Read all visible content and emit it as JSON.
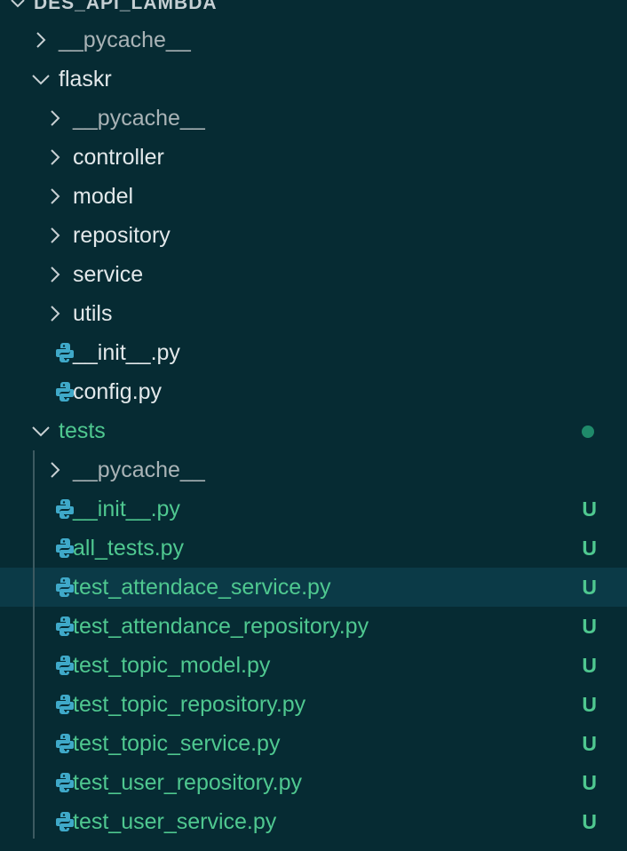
{
  "explorer": {
    "root_title": "DES_API_LAMBDA",
    "rows": [
      {
        "label": "__pycache__",
        "kind": "folder",
        "expanded": false,
        "color": "dim",
        "badge": ""
      },
      {
        "label": "flaskr",
        "kind": "folder",
        "expanded": true,
        "color": "white",
        "badge": ""
      },
      {
        "label": "__pycache__",
        "kind": "folder",
        "expanded": false,
        "color": "dim",
        "badge": ""
      },
      {
        "label": "controller",
        "kind": "folder",
        "expanded": false,
        "color": "white",
        "badge": ""
      },
      {
        "label": "model",
        "kind": "folder",
        "expanded": false,
        "color": "white",
        "badge": ""
      },
      {
        "label": "repository",
        "kind": "folder",
        "expanded": false,
        "color": "white",
        "badge": ""
      },
      {
        "label": "service",
        "kind": "folder",
        "expanded": false,
        "color": "white",
        "badge": ""
      },
      {
        "label": "utils",
        "kind": "folder",
        "expanded": false,
        "color": "white",
        "badge": ""
      },
      {
        "label": "__init__.py",
        "kind": "python-file",
        "color": "white",
        "badge": ""
      },
      {
        "label": "config.py",
        "kind": "python-file",
        "color": "white",
        "badge": ""
      },
      {
        "label": "tests",
        "kind": "folder",
        "expanded": true,
        "color": "green",
        "badge": "",
        "modified_dot": true
      },
      {
        "label": "__pycache__",
        "kind": "folder",
        "expanded": false,
        "color": "dim",
        "badge": ""
      },
      {
        "label": "__init__.py",
        "kind": "python-file",
        "color": "green",
        "badge": "U"
      },
      {
        "label": "all_tests.py",
        "kind": "python-file",
        "color": "green",
        "badge": "U"
      },
      {
        "label": "test_attendace_service.py",
        "kind": "python-file",
        "color": "green",
        "badge": "U",
        "selected": true
      },
      {
        "label": "test_attendance_repository.py",
        "kind": "python-file",
        "color": "green",
        "badge": "U"
      },
      {
        "label": "test_topic_model.py",
        "kind": "python-file",
        "color": "green",
        "badge": "U"
      },
      {
        "label": "test_topic_repository.py",
        "kind": "python-file",
        "color": "green",
        "badge": "U"
      },
      {
        "label": "test_topic_service.py",
        "kind": "python-file",
        "color": "green",
        "badge": "U"
      },
      {
        "label": "test_user_repository.py",
        "kind": "python-file",
        "color": "green",
        "badge": "U"
      },
      {
        "label": "test_user_service.py",
        "kind": "python-file",
        "color": "green",
        "badge": "U"
      }
    ]
  },
  "colors": {
    "background": "#062b33",
    "selected_row": "#0b3a47",
    "untracked_green": "#4fc890",
    "default_text": "#e2e8ea",
    "ignored_text": "#a9b3b6",
    "python_icon": "#3fa9c9"
  },
  "icons": {
    "collapsed": "chevron-right-icon",
    "expanded": "chevron-down-icon",
    "python": "python-file-icon"
  }
}
